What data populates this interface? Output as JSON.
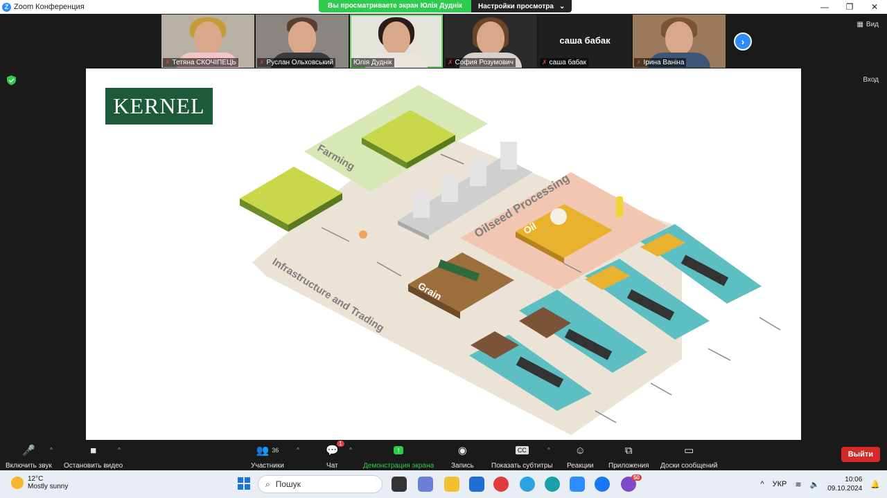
{
  "window": {
    "title": "Zoom Конференция",
    "logo": "Z"
  },
  "share_banner": {
    "status": "Вы просматриваете экран Юлія Дуднік",
    "options": "Настройки просмотра"
  },
  "win_controls": {
    "minimize": "—",
    "maximize": "❐",
    "close": "✕"
  },
  "participants": [
    {
      "name": "Тетяна СКОЧІПЕЦЬ",
      "hair": "#c79a3a",
      "body": "#f2c6c6",
      "bg": "#b7b0a3"
    },
    {
      "name": "Руслан Ольховський",
      "hair": "#5a4030",
      "body": "#3a3a3a",
      "bg": "#8a8580"
    },
    {
      "name": "Юлія Дуднік",
      "hair": "#2a1c18",
      "body": "#e9e4dc",
      "bg": "#e4e3dc"
    },
    {
      "name": "София Розумович",
      "hair": "#6b4326",
      "body": "#d6d2cb",
      "bg": "#2a2a2a"
    },
    {
      "name": "саша бабак",
      "display": "саша бабак"
    },
    {
      "name": "Ірина Ваніна",
      "hair": "#7a5436",
      "body": "#3d5577",
      "bg": "#9a7a5a"
    }
  ],
  "view_button": "Вид",
  "exit_label": "Вход",
  "next_icon": "›",
  "shared_screen": {
    "logo": "KERNEL",
    "labels": {
      "farming": "Farming",
      "oilseed": "Oilseed Processing",
      "oil": "Oil",
      "grain": "Grain",
      "infra": "Infrastructure and Trading"
    }
  },
  "toolbar": {
    "mute": "Включить звук",
    "video": "Остановить видео",
    "participants": "Участники",
    "participants_count": "36",
    "chat": "Чат",
    "chat_badge": "1",
    "share": "Демонстрация экрана",
    "record": "Запись",
    "captions": "Показать субтитры",
    "reactions": "Реакции",
    "apps": "Приложения",
    "whiteboards": "Доски сообщений",
    "leave": "Выйти"
  },
  "taskbar": {
    "temp": "12°C",
    "weather": "Mostly sunny",
    "search": "Пошук",
    "lang": "УКР",
    "time": "10:06",
    "date": "09.10.2024",
    "viber_badge": "50"
  },
  "colors": {
    "accent": "#2d8cff",
    "share_green": "#2fcb4e",
    "leave_red": "#d42a2a",
    "kernel_green": "#1d5a3a"
  }
}
